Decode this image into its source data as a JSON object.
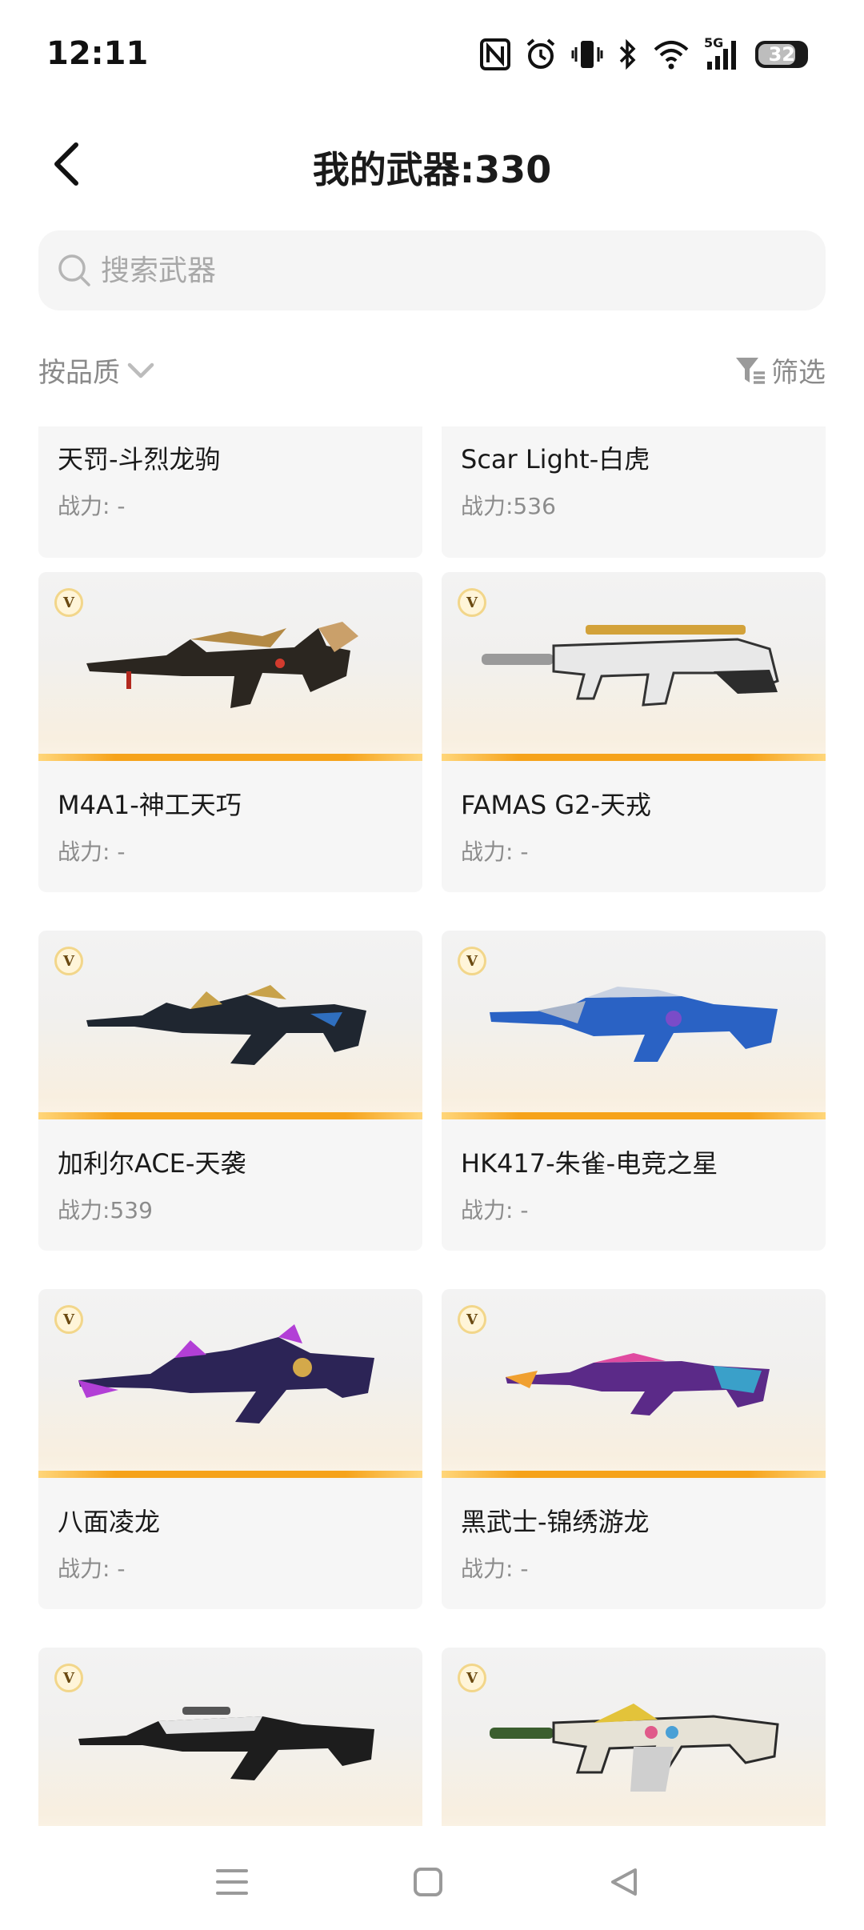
{
  "status_bar": {
    "time": "12:11",
    "icons": [
      "nfc-icon",
      "alarm-icon",
      "vibrate-icon",
      "bluetooth-icon",
      "wifi-icon",
      "signal-5g-icon",
      "battery-icon"
    ],
    "network_label": "5G",
    "battery_level": "32"
  },
  "header": {
    "title": "我的武器:330",
    "back_icon": "chevron-left-icon"
  },
  "search": {
    "placeholder": "搜索武器",
    "value": ""
  },
  "filters": {
    "sort_label": "按品质",
    "filter_label": "筛选"
  },
  "colors": {
    "accent_bar": "#f6a31b",
    "card_bg": "#f6f6f6",
    "muted_text": "#8c8c8c"
  },
  "weapons": [
    {
      "name": "天罚-斗烈龙驹",
      "power": "战力: -",
      "badge": "V"
    },
    {
      "name": "Scar Light-白虎",
      "power": "战力:536",
      "badge": "V"
    },
    {
      "name": "M4A1-神工天巧",
      "power": "战力: -",
      "badge": "V"
    },
    {
      "name": "FAMAS G2-天戎",
      "power": "战力: -",
      "badge": "V"
    },
    {
      "name": "加利尔ACE-天袭",
      "power": "战力:539",
      "badge": "V"
    },
    {
      "name": "HK417-朱雀-电竞之星",
      "power": "战力: -",
      "badge": "V"
    },
    {
      "name": "八面凌龙",
      "power": "战力: -",
      "badge": "V"
    },
    {
      "name": "黑武士-锦绣游龙",
      "power": "战力: -",
      "badge": "V"
    },
    {
      "name": "",
      "power": "",
      "badge": "V"
    },
    {
      "name": "",
      "power": "",
      "badge": "V"
    }
  ],
  "nav": {
    "items": [
      "menu-icon",
      "home-square-icon",
      "back-triangle-icon"
    ]
  }
}
